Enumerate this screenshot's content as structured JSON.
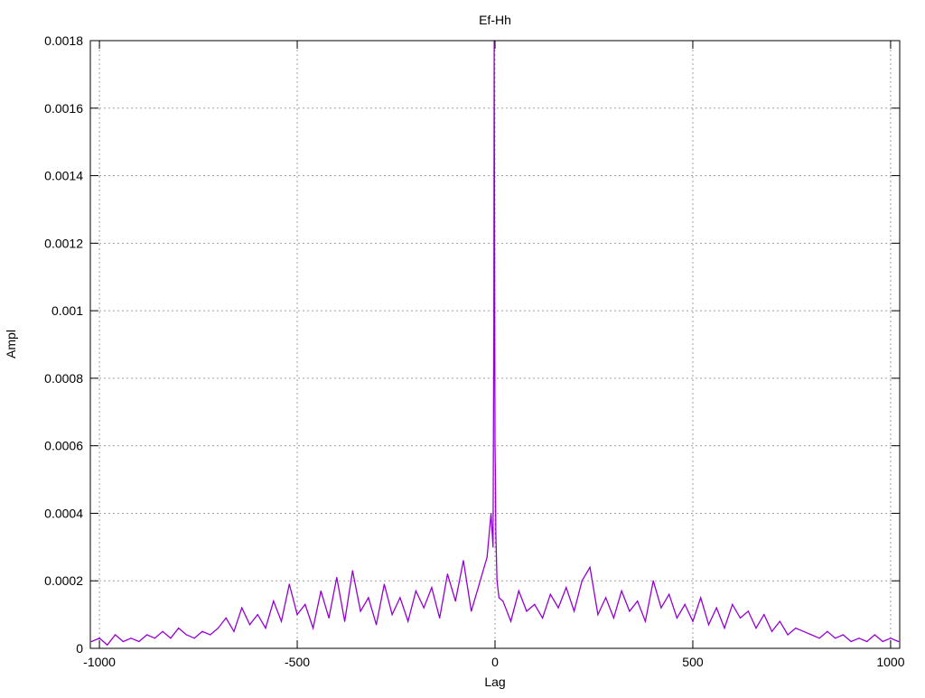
{
  "chart_data": {
    "type": "line",
    "title": "Ef-Hh",
    "xlabel": "Lag",
    "ylabel": "Ampl",
    "xlim": [
      -1023,
      1023
    ],
    "ylim": [
      0,
      0.0018
    ],
    "grid": true,
    "x_ticks": [
      -1000,
      -500,
      0,
      500,
      1000
    ],
    "x_tick_labels": [
      "-1000",
      "-500",
      "0",
      "500",
      "1000"
    ],
    "y_ticks": [
      0,
      0.0002,
      0.0004,
      0.0006,
      0.0008,
      0.001,
      0.0012,
      0.0014,
      0.0016,
      0.0018
    ],
    "y_tick_labels": [
      "0",
      "0.0002",
      "0.0004",
      "0.0006",
      "0.0008",
      "0.001",
      "0.0012",
      "0.0014",
      "0.0016",
      "0.0018"
    ],
    "series": [
      {
        "name": "Ef-Hh",
        "color": "#9400D3",
        "x": [
          -1020,
          -1000,
          -980,
          -960,
          -940,
          -920,
          -900,
          -880,
          -860,
          -840,
          -820,
          -800,
          -780,
          -760,
          -740,
          -720,
          -700,
          -680,
          -660,
          -640,
          -620,
          -600,
          -580,
          -560,
          -540,
          -520,
          -500,
          -480,
          -460,
          -440,
          -420,
          -400,
          -380,
          -360,
          -340,
          -320,
          -300,
          -280,
          -260,
          -240,
          -220,
          -200,
          -180,
          -160,
          -140,
          -120,
          -100,
          -80,
          -60,
          -40,
          -20,
          -10,
          -5,
          -3,
          -2,
          -1,
          0,
          1,
          2,
          5,
          10,
          20,
          40,
          60,
          80,
          100,
          120,
          140,
          160,
          180,
          200,
          220,
          240,
          260,
          280,
          300,
          320,
          340,
          360,
          380,
          400,
          420,
          440,
          460,
          480,
          500,
          520,
          540,
          560,
          580,
          600,
          620,
          640,
          660,
          680,
          700,
          720,
          740,
          760,
          780,
          800,
          820,
          840,
          860,
          880,
          900,
          920,
          940,
          960,
          980,
          1000,
          1020
        ],
        "y": [
          2e-05,
          3e-05,
          1e-05,
          4e-05,
          2e-05,
          3e-05,
          2e-05,
          4e-05,
          3e-05,
          5e-05,
          3e-05,
          6e-05,
          4e-05,
          3e-05,
          5e-05,
          4e-05,
          6e-05,
          9e-05,
          5e-05,
          0.00012,
          7e-05,
          0.0001,
          6e-05,
          0.00014,
          8e-05,
          0.00019,
          0.0001,
          0.00013,
          6e-05,
          0.00017,
          9e-05,
          0.00021,
          8e-05,
          0.00023,
          0.00011,
          0.00015,
          7e-05,
          0.00019,
          0.0001,
          0.00015,
          8e-05,
          0.00017,
          0.00012,
          0.00018,
          9e-05,
          0.00022,
          0.00014,
          0.00026,
          0.00011,
          0.00019,
          0.00027,
          0.0004,
          0.0003,
          0.00095,
          0.0018,
          0.00108,
          0.0006,
          0.00052,
          0.00034,
          0.0002,
          0.00015,
          0.00014,
          8e-05,
          0.00017,
          0.00011,
          0.00013,
          9e-05,
          0.00016,
          0.00012,
          0.00018,
          0.00011,
          0.0002,
          0.00024,
          0.0001,
          0.00015,
          9e-05,
          0.00017,
          0.00011,
          0.00014,
          8e-05,
          0.0002,
          0.00012,
          0.00016,
          9e-05,
          0.00013,
          8e-05,
          0.00015,
          7e-05,
          0.00012,
          6e-05,
          0.00013,
          9e-05,
          0.00011,
          6e-05,
          0.0001,
          5e-05,
          8e-05,
          4e-05,
          6e-05,
          5e-05,
          4e-05,
          3e-05,
          5e-05,
          3e-05,
          4e-05,
          2e-05,
          3e-05,
          2e-05,
          4e-05,
          2e-05,
          3e-05,
          2e-05
        ]
      }
    ]
  }
}
